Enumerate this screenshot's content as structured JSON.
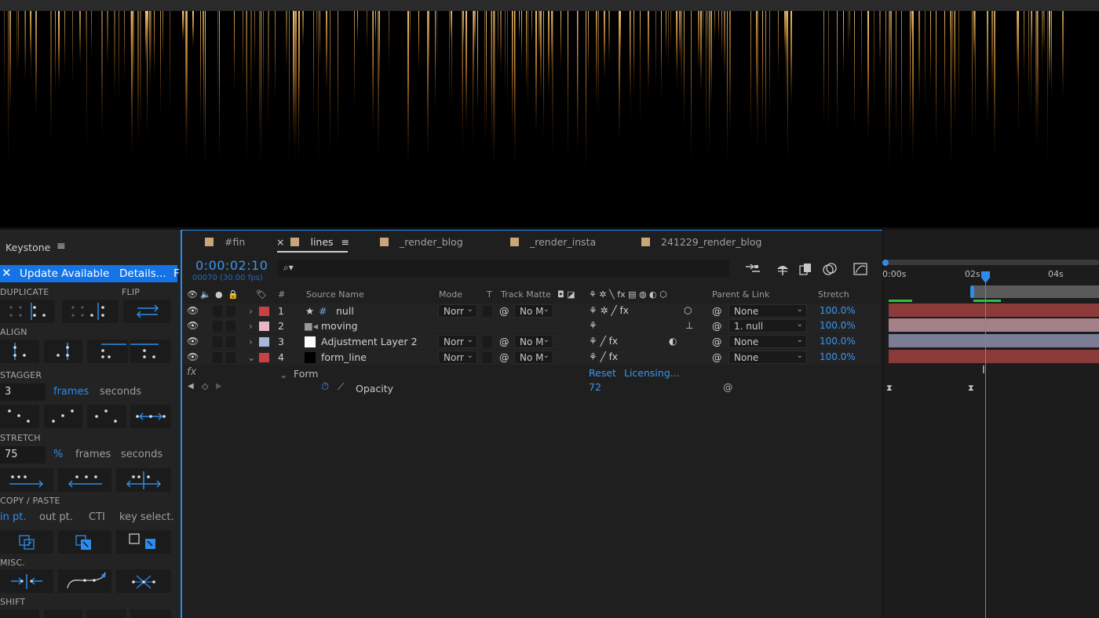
{
  "keystone": {
    "title": "Keystone",
    "menu_icon": "≡",
    "update": {
      "close": "✕",
      "text": "Update Available",
      "details": "Details...",
      "more": "F"
    },
    "sections": {
      "duplicate": "DUPLICATE",
      "flip": "FLIP",
      "align": "ALIGN",
      "stagger": "STAGGER",
      "stretch": "STRETCH",
      "copy_paste": "COPY / PASTE",
      "misc": "MISC.",
      "shift": "SHIFT"
    },
    "stagger": {
      "value": "3",
      "unit_frames": "frames",
      "unit_seconds": "seconds"
    },
    "stretch": {
      "value": "75",
      "unit_percent": "%",
      "unit_frames": "frames",
      "unit_seconds": "seconds"
    },
    "copy_paste": {
      "in": "in pt.",
      "out": "out pt.",
      "cti": "CTI",
      "key": "key select."
    }
  },
  "timeline": {
    "tabs": [
      {
        "label": "#fin"
      },
      {
        "label": "lines",
        "close": "×",
        "menu": "≡"
      },
      {
        "label": "_render_blog"
      },
      {
        "label": "_render_insta"
      },
      {
        "label": "241229_render_blog"
      }
    ],
    "timecode": "0:00:02:10",
    "fps": "00070 (30.00 fps)",
    "search_icon": "⌕▾",
    "columns": {
      "num": "#",
      "source": "Source Name",
      "mode": "Mode",
      "t": "T",
      "track_matte": "Track Matte",
      "parent": "Parent & Link",
      "stretch": "Stretch"
    },
    "layers": [
      {
        "num": "1",
        "name": "null",
        "mode": "Norr",
        "matte": "No M",
        "parent": "None",
        "stretch": "100.0%",
        "color": "#c94141"
      },
      {
        "num": "2",
        "name": "moving",
        "mode": "",
        "matte": "",
        "parent": "1. null",
        "stretch": "100.0%",
        "color": "#e8b7c6"
      },
      {
        "num": "3",
        "name": "Adjustment Layer 2",
        "mode": "Norr",
        "matte": "No M",
        "parent": "None",
        "stretch": "100.0%",
        "color": "#a6b7d8"
      },
      {
        "num": "4",
        "name": "form_line",
        "mode": "Norr",
        "matte": "No M",
        "parent": "None",
        "stretch": "100.0%",
        "color": "#c94141"
      }
    ],
    "effect": {
      "fx": "fx",
      "name": "Form",
      "reset": "Reset",
      "licensing": "Licensing..."
    },
    "property": {
      "name": "Opacity",
      "value": "72"
    },
    "ruler": {
      "t0": "0:00s",
      "t2": "02s",
      "t4": "04s"
    },
    "bar_colors": [
      "#8b3a3a",
      "#a48189",
      "#7c7c95",
      "#8b3a3a"
    ]
  }
}
